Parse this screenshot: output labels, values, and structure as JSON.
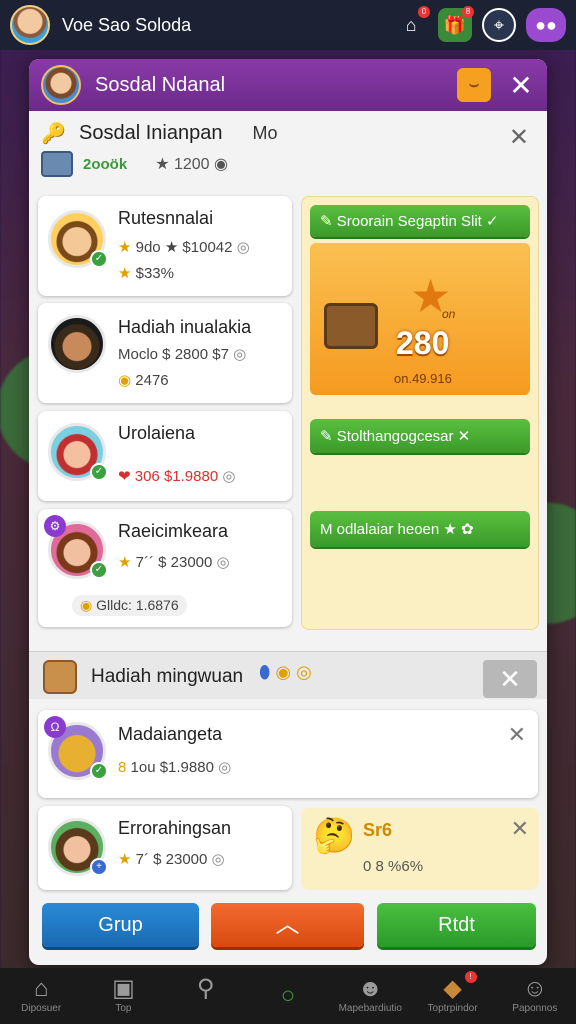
{
  "topbar": {
    "title": "Voe Sao Soloda",
    "icons": [
      "house-icon",
      "gift-icon",
      "compass-icon",
      "chat-icon"
    ],
    "badges": [
      "0",
      "8"
    ]
  },
  "modal": {
    "title": "Sosdal Ndanal",
    "section": {
      "title": "Sosdal Inianpan",
      "suffix": "Mo",
      "coins": "2ooök",
      "stars": "1200"
    },
    "players": [
      {
        "name": "Rutesnnalai",
        "line1": "9do ★ $10042",
        "line2": "$33%"
      },
      {
        "name": "Hadiah inualakia",
        "line1": "Moclo $ 2800 $7",
        "line2": "2476"
      },
      {
        "name": "Urolaiena",
        "line1": "306 $1.9880",
        "line2": ""
      },
      {
        "name": "Raeicimkeara",
        "line1": "7´´ $ 23000",
        "line2": "Glldc: 1.6876"
      }
    ],
    "right_panel": {
      "top_button": "Sroorain Segaptin Slit",
      "reward_value": "280",
      "reward_tag": "on",
      "reward_sub": "on.49.916",
      "mid_button": "Stolthangogcesar",
      "bottom_button": "M odlalaiar heoen"
    },
    "weekly": {
      "title": "Hadiah mingwuan",
      "items": [
        {
          "name": "Madaiangeta",
          "line1": "1ou $1.9880"
        },
        {
          "name": "Errorahingsan",
          "line1": "7´ $ 23000"
        }
      ],
      "mini": {
        "title": "Sr6",
        "line": "0 8 %6%"
      }
    },
    "buttons": {
      "left": "Grup",
      "right": "Rtdt"
    }
  },
  "bottomnav": {
    "items": [
      "Diposuer",
      "Top",
      "",
      "Mapebardiutio",
      "Toptrpindor",
      "Paponnos"
    ]
  },
  "colors": {
    "header_purple": "#7a2e98",
    "accent_green": "#3a9a2a",
    "accent_orange": "#f59a20",
    "panel_cream": "#faf0c4"
  }
}
